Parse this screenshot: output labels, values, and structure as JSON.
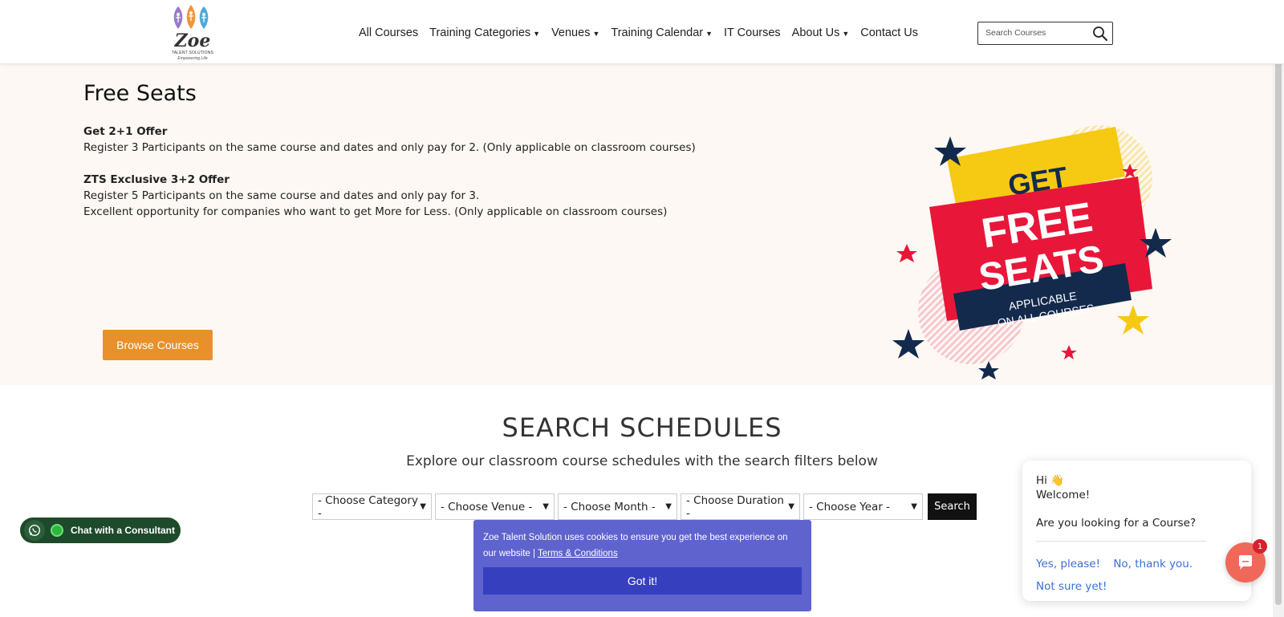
{
  "logo": {
    "name": "Zoe",
    "sub": "TALENT SOLUTIONS",
    "tagline": "Empowering Life"
  },
  "nav": {
    "items": [
      {
        "label": "All Courses",
        "dropdown": false
      },
      {
        "label": "Training Categories",
        "dropdown": true
      },
      {
        "label": "Venues",
        "dropdown": true
      },
      {
        "label": "Training Calendar",
        "dropdown": true
      },
      {
        "label": "IT Courses",
        "dropdown": false
      },
      {
        "label": "About Us",
        "dropdown": true
      },
      {
        "label": "Contact Us",
        "dropdown": false
      }
    ]
  },
  "search": {
    "placeholder": "Search Courses",
    "icon": "search-icon"
  },
  "hero": {
    "title": "Free Seats",
    "offer1_title": "Get 2+1 Offer",
    "offer1_text": "Register 3 Participants on the same course and dates and only pay for 2. (Only applicable on classroom courses)",
    "offer2_title": "ZTS Exclusive 3+2 Offer",
    "offer2_line1": "Register 5 Participants on the same course and dates and only pay for 3.",
    "offer2_line2": "Excellent opportunity for companies who want to get More for Less. (Only applicable on classroom courses)",
    "browse_label": "Browse Courses",
    "banner": {
      "get": "GET",
      "free": "FREE",
      "seats": "SEATS",
      "applicable": "APPLICABLE",
      "on_all": "ON ALL COURSES",
      "colors": {
        "red": "#e8173a",
        "yellow": "#f6c913",
        "navy": "#132a4d"
      }
    }
  },
  "schedules": {
    "title": "SEARCH SCHEDULES",
    "subtitle": "Explore our classroom course schedules with the search filters below",
    "filters": [
      "- Choose Category -",
      "- Choose Venue -",
      "- Choose Month -",
      "- Choose Duration -",
      "- Choose Year -"
    ],
    "search_label": "Search"
  },
  "whatsapp": {
    "label": "Chat with a Consultant",
    "icon": "whatsapp-icon"
  },
  "cookie": {
    "text": "Zoe Talent Solution uses cookies to ensure you get the best experience on our website |",
    "link": "Terms & Conditions",
    "button": "Got it!"
  },
  "chat": {
    "hi": "Hi 👋",
    "welcome": "Welcome!",
    "question": "Are you looking for a Course?",
    "opt_yes": "Yes, please!",
    "opt_no": "No, thank you.",
    "opt_unsure": "Not sure yet!",
    "badge": "1"
  },
  "colors": {
    "accent": "#e8912b",
    "cookie_bg": "#5e63cd",
    "cookie_btn": "#3640bf",
    "chat_link": "#3970d4",
    "chat_fab": "#f0685a"
  }
}
